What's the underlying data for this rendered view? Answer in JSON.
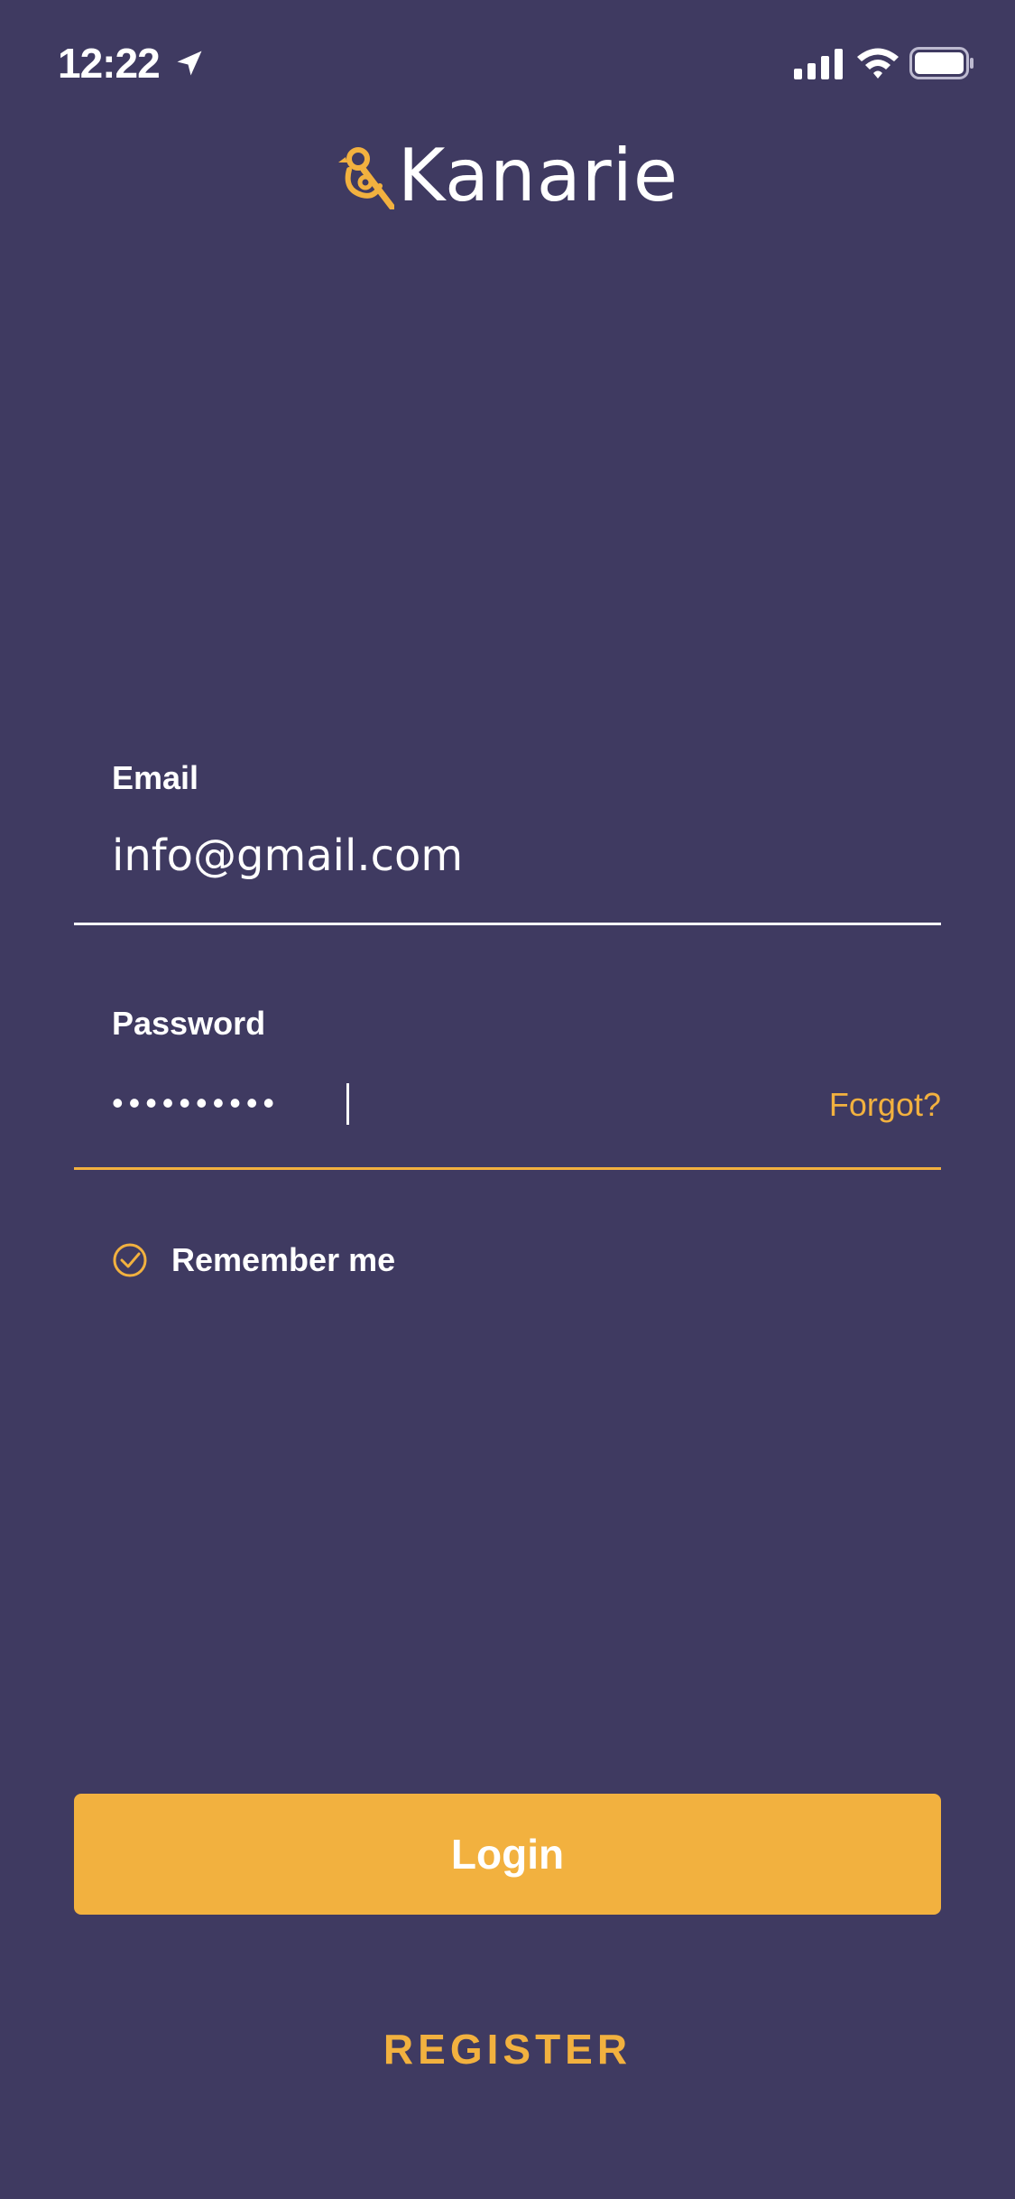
{
  "status_bar": {
    "time": "12:22",
    "icons": [
      "location-arrow-icon",
      "signal-icon",
      "wifi-icon",
      "battery-icon"
    ]
  },
  "logo": {
    "text": "Kanarie",
    "mark_icon": "canary-bird-icon"
  },
  "form": {
    "email": {
      "label": "Email",
      "value": "info@gmail.com"
    },
    "password": {
      "label": "Password",
      "masked_value": "••••••••••",
      "forgot_label": "Forgot?"
    },
    "remember": {
      "label": "Remember me",
      "checked": true
    }
  },
  "actions": {
    "login_label": "Login",
    "register_label": "REGISTER"
  },
  "colors": {
    "background": "#3f3a61",
    "accent": "#f2b13f",
    "text": "#ffffff"
  }
}
